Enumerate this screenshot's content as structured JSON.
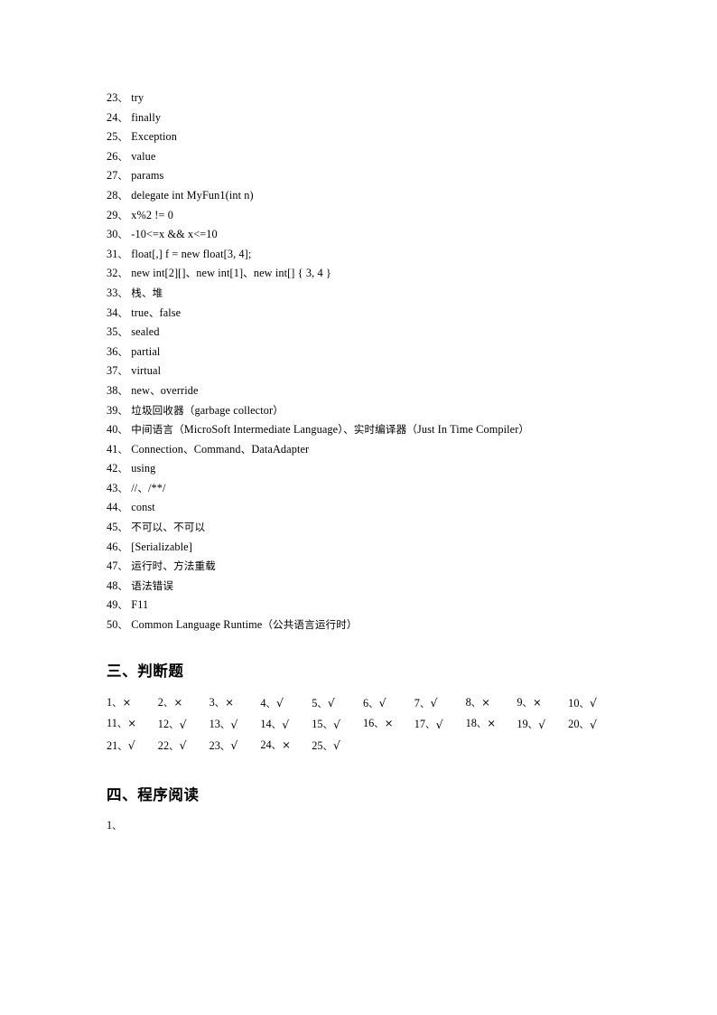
{
  "document": {
    "page_background": "#ffffff",
    "text_color": "#000000"
  },
  "fill_in_answers": {
    "items": [
      {
        "num": "23",
        "sep": "、",
        "text": "try"
      },
      {
        "num": "24",
        "sep": "、",
        "text": "finally"
      },
      {
        "num": "25",
        "sep": "、",
        "text": "Exception"
      },
      {
        "num": "26",
        "sep": "、",
        "text": "value"
      },
      {
        "num": "27",
        "sep": "、",
        "text": "params"
      },
      {
        "num": "28",
        "sep": "、",
        "text": "delegate int MyFun1(int n)"
      },
      {
        "num": "29",
        "sep": "、",
        "text": "x%2 != 0"
      },
      {
        "num": "30",
        "sep": "、",
        "text": "-10<=x && x<=10"
      },
      {
        "num": "31",
        "sep": "、",
        "text": "float[,] f = new float[3, 4];"
      },
      {
        "num": "32",
        "sep": "、",
        "text": "new int[2][]、new int[1]、new int[] { 3, 4 }"
      },
      {
        "num": "33",
        "sep": "、",
        "text": "栈、堆"
      },
      {
        "num": "34",
        "sep": "、",
        "text": "true、false"
      },
      {
        "num": "35",
        "sep": "、",
        "text": "sealed"
      },
      {
        "num": "36",
        "sep": "、",
        "text": "partial"
      },
      {
        "num": "37",
        "sep": "、",
        "text": "virtual"
      },
      {
        "num": "38",
        "sep": "、",
        "text": "new、override"
      },
      {
        "num": "39",
        "sep": "、",
        "text": "垃圾回收器（garbage collector）"
      },
      {
        "num": "40",
        "sep": "、",
        "text": "中间语言（MicroSoft Intermediate Language）、实时编译器（Just In Time Compiler）"
      },
      {
        "num": "41",
        "sep": "、",
        "text": "Connection、Command、DataAdapter"
      },
      {
        "num": "42",
        "sep": "、",
        "text": "using"
      },
      {
        "num": "43",
        "sep": "、",
        "text": "//、/**/"
      },
      {
        "num": "44",
        "sep": "、",
        "text": "const"
      },
      {
        "num": "45",
        "sep": "、",
        "text": "不可以、不可以"
      },
      {
        "num": "46",
        "sep": "、",
        "text": "[Serializable]"
      },
      {
        "num": "47",
        "sep": "、",
        "text": "运行时、方法重载"
      },
      {
        "num": "48",
        "sep": "、",
        "text": "语法错误"
      },
      {
        "num": "49",
        "sep": "、",
        "text": "F11"
      },
      {
        "num": "50",
        "sep": "、",
        "text": "Common Language Runtime（公共语言运行时）"
      }
    ]
  },
  "true_false_section": {
    "heading": "三、判断题",
    "answers": [
      {
        "num": "1",
        "sep": "、",
        "mark": "×"
      },
      {
        "num": "2",
        "sep": "、",
        "mark": "×"
      },
      {
        "num": "3",
        "sep": "、",
        "mark": "×"
      },
      {
        "num": "4",
        "sep": "、",
        "mark": "√"
      },
      {
        "num": "5",
        "sep": "、",
        "mark": "√"
      },
      {
        "num": "6",
        "sep": "、",
        "mark": "√"
      },
      {
        "num": "7",
        "sep": "、",
        "mark": "√"
      },
      {
        "num": "8",
        "sep": "、",
        "mark": "×"
      },
      {
        "num": "9",
        "sep": "、",
        "mark": "×"
      },
      {
        "num": "10",
        "sep": "、",
        "mark": "√"
      },
      {
        "num": "11",
        "sep": "、",
        "mark": "×"
      },
      {
        "num": "12",
        "sep": "、",
        "mark": "√"
      },
      {
        "num": "13",
        "sep": "、",
        "mark": "√"
      },
      {
        "num": "14",
        "sep": "、",
        "mark": "√"
      },
      {
        "num": "15",
        "sep": "、",
        "mark": "√"
      },
      {
        "num": "16",
        "sep": "、",
        "mark": "×"
      },
      {
        "num": "17",
        "sep": "、",
        "mark": "√"
      },
      {
        "num": "18",
        "sep": "、",
        "mark": "×"
      },
      {
        "num": "19",
        "sep": "、",
        "mark": "√"
      },
      {
        "num": "20",
        "sep": "、",
        "mark": "√"
      },
      {
        "num": "21",
        "sep": "、",
        "mark": "√"
      },
      {
        "num": "22",
        "sep": "、",
        "mark": "√"
      },
      {
        "num": "23",
        "sep": "、",
        "mark": "√"
      },
      {
        "num": "24",
        "sep": "、",
        "mark": "×"
      },
      {
        "num": "25",
        "sep": "、",
        "mark": "√"
      }
    ]
  },
  "reading_section": {
    "heading": "四、程序阅读",
    "items": [
      {
        "num": "1",
        "sep": "、",
        "text": ""
      }
    ]
  }
}
